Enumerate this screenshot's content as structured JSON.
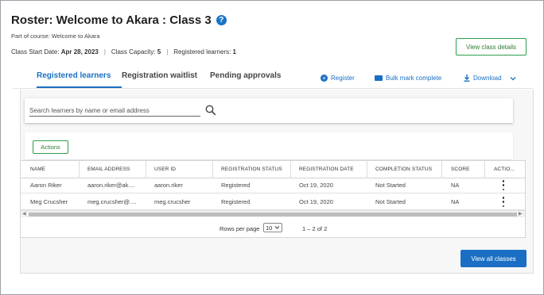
{
  "header": {
    "title": "Roster: Welcome to Akara : Class 3",
    "help_icon": "?",
    "subtitle": "Part of course: Welcome to Akara",
    "start_date_label": "Class Start Date:",
    "start_date_value": "Apr 28, 2023",
    "capacity_label": "Class Capacity:",
    "capacity_value": "5",
    "registered_label": "Registered learners:",
    "registered_value": "1",
    "separator": "|",
    "view_details_label": "View class details"
  },
  "tabs": [
    {
      "label": "Registered learners",
      "active": true
    },
    {
      "label": "Registration waitlist",
      "active": false
    },
    {
      "label": "Pending approvals",
      "active": false
    }
  ],
  "toolbar": {
    "register_label": "Register",
    "register_icon": "plus-circle-icon",
    "bulk_label": "Bulk mark complete",
    "bulk_icon": "folder-icon",
    "download_label": "Download",
    "download_icon": "download-icon"
  },
  "search": {
    "placeholder": "Search learners by name or email address",
    "value": ""
  },
  "actions_label": "Actions",
  "table": {
    "columns": [
      "NAME",
      "EMAIL ADDRESS",
      "USER ID",
      "REGISTRATION STATUS",
      "REGISTRATION DATE",
      "COMPLETION STATUS",
      "SCORE",
      "ACTIO..."
    ],
    "rows": [
      {
        "name": "Aaron Riker",
        "email": "aaron.riker@ak....",
        "user_id": "aaron.riker",
        "reg_status": "Registered",
        "reg_date": "Oct 19, 2020",
        "completion": "Not Started",
        "score": "NA"
      },
      {
        "name": "Meg Crucsher",
        "email": "meg.crucsher@....",
        "user_id": "meg.crucsher",
        "reg_status": "Registered",
        "reg_date": "Oct 19, 2020",
        "completion": "Not Started",
        "score": "NA"
      }
    ]
  },
  "pager": {
    "rows_per_page_label": "Rows per page",
    "rows_per_page_value": "10",
    "range": "1 – 2 of 2"
  },
  "view_all_label": "View all classes",
  "colors": {
    "primary": "#1a6fc4",
    "green_outline": "#2e9e4f",
    "help_icon": "#1a73c8"
  }
}
